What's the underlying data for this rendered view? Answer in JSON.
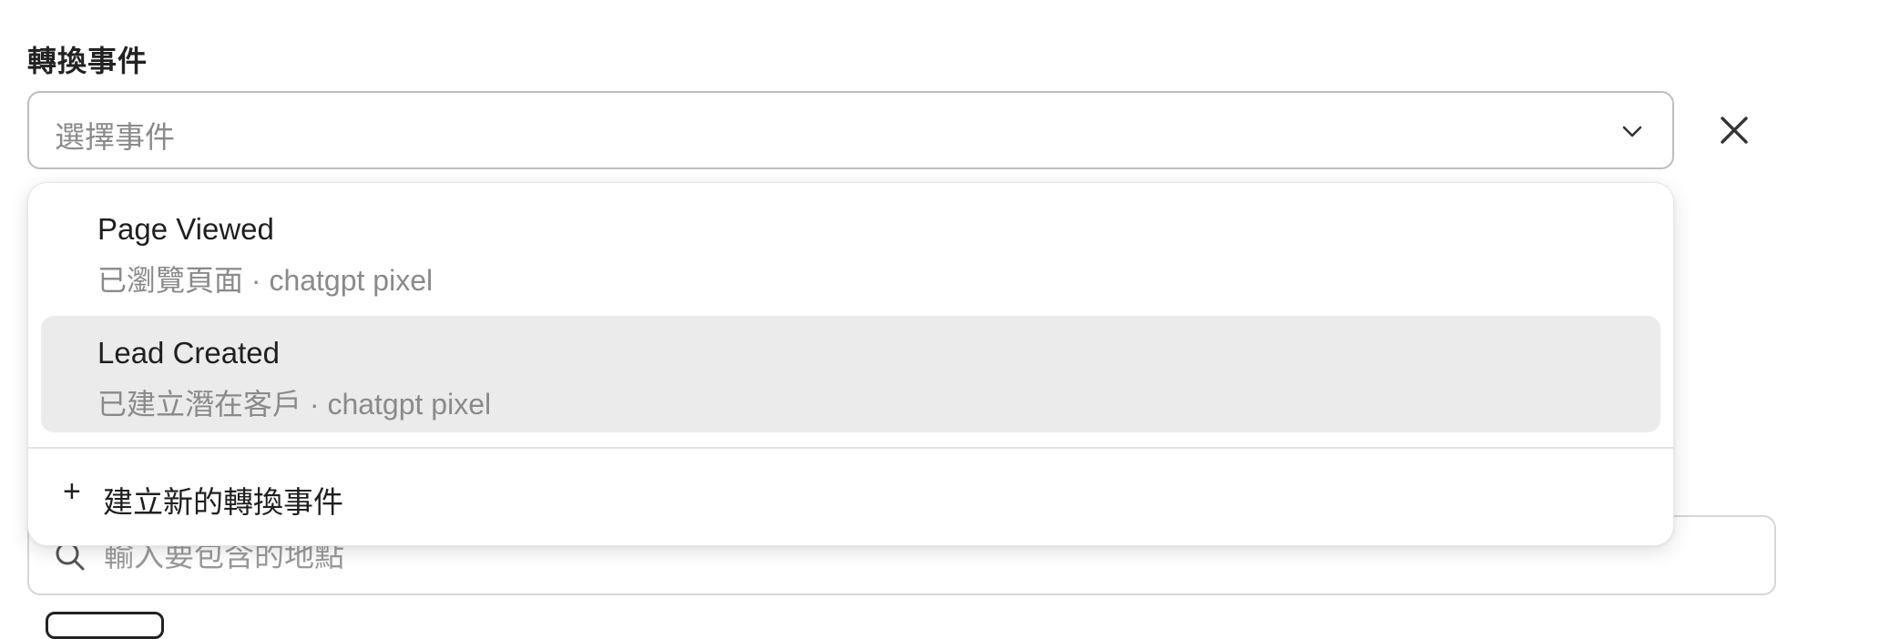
{
  "field": {
    "label": "轉換事件",
    "placeholder": "選擇事件"
  },
  "icons": {
    "chevron": "chevron-down-icon",
    "close": "close-icon",
    "search": "search-icon",
    "plus": "plus-icon"
  },
  "dropdown": {
    "options": [
      {
        "title": "Page Viewed",
        "subtitle": "已瀏覽頁面 · chatgpt pixel",
        "highlighted": false
      },
      {
        "title": "Lead Created",
        "subtitle": "已建立潛在客戶 · chatgpt pixel",
        "highlighted": true
      }
    ],
    "create": {
      "icon_glyph": "+",
      "label": "建立新的轉換事件"
    }
  },
  "location": {
    "placeholder": "輸入要包含的地點"
  },
  "colors": {
    "highlight_bg": "#ebebeb",
    "placeholder_text": "#8a8a8a",
    "border": "#bdbdbd"
  }
}
